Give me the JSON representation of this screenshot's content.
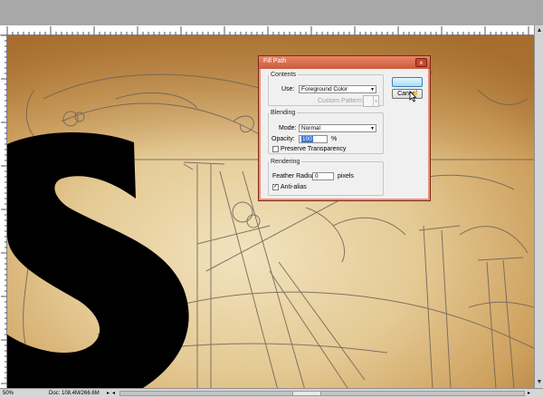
{
  "status": {
    "zoom": "50%",
    "doc_info": "Doc: 108.4M/266.6M"
  },
  "dialog": {
    "title": "Fill Path",
    "ok_label": "",
    "cancel_label": "Cancel",
    "contents": {
      "legend": "Contents",
      "use_label": "Use:",
      "use_value": "Foreground Color",
      "custom_pattern_label": "Custom Pattern:"
    },
    "blending": {
      "legend": "Blending",
      "mode_label": "Mode:",
      "mode_value": "Normal",
      "opacity_label": "Opacity:",
      "opacity_value": "100",
      "opacity_unit": "%",
      "preserve_transparency_label": "Preserve Transparency",
      "preserve_transparency_checked": false
    },
    "rendering": {
      "legend": "Rendering",
      "feather_label": "Feather Radius:",
      "feather_value": "0",
      "feather_unit": "pixels",
      "antialias_label": "Anti-alias",
      "antialias_checked": true
    }
  },
  "colors": {
    "parchment_light": "#e6cfa0",
    "parchment_dark": "#b07a3a",
    "sketch_line": "#6d6258",
    "letter_fill": "#000000",
    "dialog_title": "#d9684a",
    "accent_button": "#a9dcf4"
  },
  "icons": {
    "close": "close-icon",
    "cursor": "pointer-cursor-icon",
    "scroll_up": "arrow-up-icon",
    "scroll_down": "arrow-down-icon"
  }
}
